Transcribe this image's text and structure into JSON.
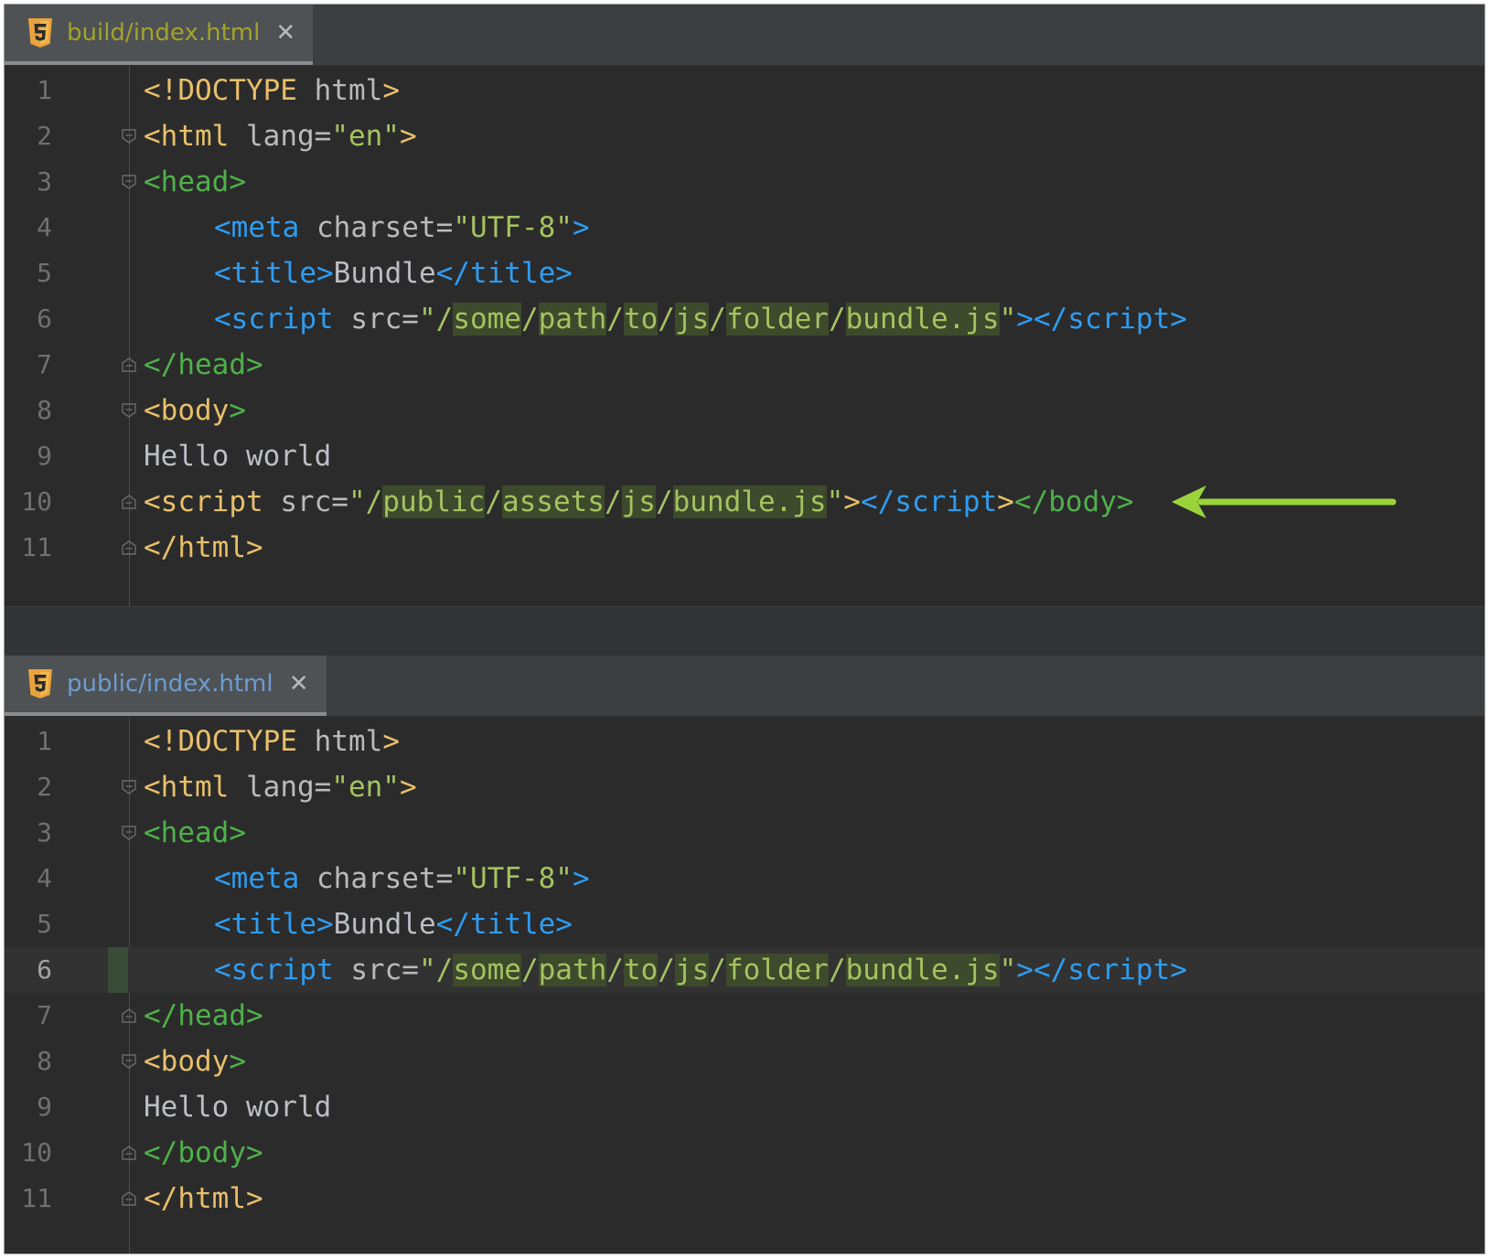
{
  "top_pane": {
    "tab_label": "build/index.html",
    "tab_color": "#a3a32b",
    "line_numbers": [
      "1",
      "2",
      "3",
      "4",
      "5",
      "6",
      "7",
      "8",
      "9",
      "10",
      "11"
    ],
    "lines": {
      "l1": {
        "a": "<!DOCTYPE",
        "b": " html",
        "c": ">"
      },
      "l2": {
        "a": "<html",
        "b": " lang=",
        "c": "\"en\"",
        "d": ">"
      },
      "l3": {
        "a": "<head",
        "b": ">"
      },
      "l4": {
        "a": "<meta",
        "b": " charset=",
        "c": "\"UTF-8\"",
        "d": ">"
      },
      "l5": {
        "a": "<title",
        "b": ">",
        "c": "Bundle",
        "d": "</title",
        "e": ">"
      },
      "l6": {
        "a": "<script",
        "b": " src=",
        "q1": "\"/",
        "p1": "some",
        "s1": "/",
        "p2": "path",
        "s2": "/",
        "p3": "to",
        "s3": "/",
        "p4": "js",
        "s4": "/",
        "p5": "folder",
        "s5": "/",
        "p6": "bundle.js",
        "q2": "\"",
        "c": ">",
        "d": "</script",
        "e": ">"
      },
      "l7": {
        "a": "</head",
        "b": ">"
      },
      "l8": {
        "a": "<body",
        "b": ">"
      },
      "l9": {
        "a": "Hello world"
      },
      "l10": {
        "a": "<script",
        "b": " src=",
        "q1": "\"/",
        "p1": "public",
        "s1": "/",
        "p2": "assets",
        "s2": "/",
        "p3": "js",
        "s3": "/",
        "p4": "bundle.js",
        "q2": "\"",
        "c": ">",
        "d": "</script",
        "e": ">",
        "f": "</body",
        "g": ">"
      },
      "l11": {
        "a": "</html",
        "b": ">"
      }
    }
  },
  "bottom_pane": {
    "tab_label": "public/index.html",
    "tab_color": "#6e9cd0",
    "line_numbers": [
      "1",
      "2",
      "3",
      "4",
      "5",
      "6",
      "7",
      "8",
      "9",
      "10",
      "11"
    ],
    "lines": {
      "l1": {
        "a": "<!DOCTYPE",
        "b": " html",
        "c": ">"
      },
      "l2": {
        "a": "<html",
        "b": " lang=",
        "c": "\"en\"",
        "d": ">"
      },
      "l3": {
        "a": "<head",
        "b": ">"
      },
      "l4": {
        "a": "<meta",
        "b": " charset=",
        "c": "\"UTF-8\"",
        "d": ">"
      },
      "l5": {
        "a": "<title",
        "b": ">",
        "c": "Bundle",
        "d": "</title",
        "e": ">"
      },
      "l6": {
        "a": "<script",
        "b": " src=",
        "q1": "\"/",
        "p1": "some",
        "s1": "/",
        "p2": "path",
        "s2": "/",
        "p3": "to",
        "s3": "/",
        "p4": "js",
        "s4": "/",
        "p5": "folder",
        "s5": "/",
        "p6": "bundle.js",
        "q2": "\"",
        "c": ">",
        "d": "</script",
        "e": ">"
      },
      "l7": {
        "a": "</head",
        "b": ">"
      },
      "l8": {
        "a": "<body",
        "b": ">"
      },
      "l9": {
        "a": "Hello world"
      },
      "l10": {
        "a": "</body",
        "b": ">"
      },
      "l11": {
        "a": "</html",
        "b": ">"
      }
    }
  },
  "icons": {
    "file_icon": "html5-icon",
    "close_icon": "close-icon",
    "fold_icon": "fold-marker-icon",
    "arrow": "arrow-left-icon"
  },
  "colors": {
    "arrow": "#9ad43a",
    "tag_yellow": "#e8bf6a",
    "tag_blue": "#2f9cf0",
    "tag_green": "#4fb04a",
    "string": "#a5c261"
  },
  "tab_close_glyph": "✕"
}
